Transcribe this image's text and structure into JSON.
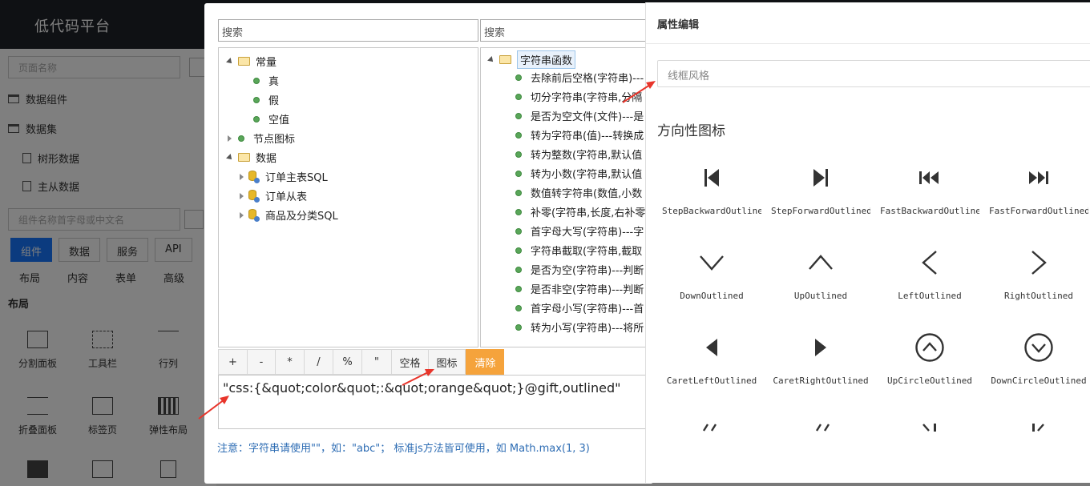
{
  "bg": {
    "brand": "低代码平台",
    "page_search_placeholder": "页面名称",
    "sidebar_items": [
      "数据组件",
      "数据集"
    ],
    "dataset_children": [
      "树形数据",
      "主从数据"
    ],
    "component_search_placeholder": "组件名称首字母或中文名",
    "tabs": [
      "组件",
      "数据",
      "服务",
      "API"
    ],
    "subtabs": [
      "布局",
      "内容",
      "表单",
      "高级"
    ],
    "section": "布局",
    "components": [
      "分割面板",
      "工具栏",
      "行列",
      "折叠面板",
      "标签页",
      "弹性布局"
    ]
  },
  "dialog": {
    "left_search": "搜索",
    "right_search": "搜索",
    "left_tree": {
      "constants": {
        "label": "常量",
        "children": [
          "真",
          "假",
          "空值"
        ]
      },
      "node_icon": {
        "label": "节点图标"
      },
      "data": {
        "label": "数据",
        "children": [
          "订单主表SQL",
          "订单从表",
          "商品及分类SQL"
        ]
      }
    },
    "right_tree": {
      "label": "字符串函数",
      "children": [
        "去除前后空格(字符串)---",
        "切分字符串(字符串,分隔",
        "是否为空文件(文件)---是",
        "转为字符串(值)---转换成",
        "转为整数(字符串,默认值",
        "转为小数(字符串,默认值",
        "数值转字符串(数值,小数",
        "补零(字符串,长度,右补零",
        "首字母大写(字符串)---字",
        "字符串截取(字符串,截取",
        "是否为空(字符串)---判断",
        "是否非空(字符串)---判断",
        "首字母小写(字符串)---首",
        "转为小写(字符串)---将所"
      ]
    },
    "operators": [
      "+",
      "-",
      "*",
      "/",
      "%",
      "\"",
      "空格",
      "图标"
    ],
    "clear_label": "清除",
    "expression": "\"css:{&quot;color&quot;:&quot;orange&quot;}@gift,outlined\"",
    "note": "注意：字符串请使用\"\"，如：\"abc\"； 标准js方法皆可使用，如 Math.max(1, 3)"
  },
  "property_panel": {
    "title": "属性编辑",
    "style_placeholder": "线框风格",
    "section_title": "方向性图标",
    "icons": [
      {
        "name": "StepBackwardOutlined",
        "icon": "step-backward-icon"
      },
      {
        "name": "StepForwardOutlined",
        "icon": "step-forward-icon"
      },
      {
        "name": "FastBackwardOutlined",
        "icon": "fast-backward-icon"
      },
      {
        "name": "FastForwardOutlined",
        "icon": "fast-forward-icon"
      },
      {
        "name": "DownOutlined",
        "icon": "down-icon"
      },
      {
        "name": "UpOutlined",
        "icon": "up-icon"
      },
      {
        "name": "LeftOutlined",
        "icon": "left-icon"
      },
      {
        "name": "RightOutlined",
        "icon": "right-icon"
      },
      {
        "name": "CaretLeftOutlined",
        "icon": "caret-left-icon"
      },
      {
        "name": "CaretRightOutlined",
        "icon": "caret-right-icon"
      },
      {
        "name": "UpCircleOutlined",
        "icon": "up-circle-icon"
      },
      {
        "name": "DownCircleOutlined",
        "icon": "down-circle-icon"
      }
    ]
  },
  "colors": {
    "accent_blue": "#1677ff",
    "clear_orange": "#f5a33c",
    "note_blue": "#2e6db4",
    "tree_dot_green": "#59a659",
    "annotation_red": "#e8352b"
  }
}
